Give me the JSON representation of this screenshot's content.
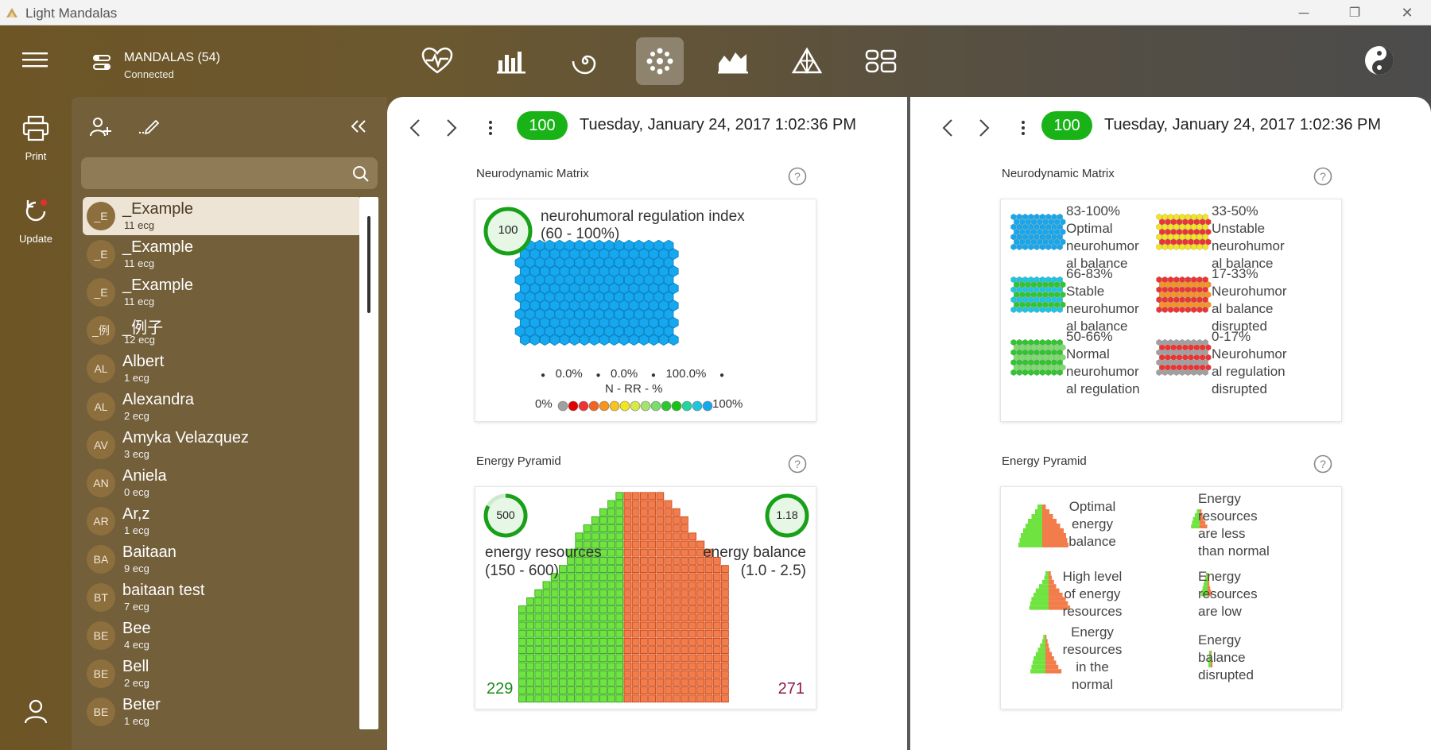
{
  "window": {
    "title": "Light Mandalas",
    "minimize": "─",
    "restore": "❐",
    "close": "✕"
  },
  "header": {
    "connection_title": "MANDALAS (54)",
    "connection_status": "Connected",
    "toolbar_icons": [
      "heart-pulse-icon",
      "bar-chart-icon",
      "spiral-icon",
      "mandala-icon",
      "area-chart-icon",
      "pyramid-icon",
      "layout-grid-icon"
    ],
    "active_icon": "mandala-icon"
  },
  "rail": {
    "print_label": "Print",
    "update_label": "Update"
  },
  "sidebar": {
    "search_placeholder": "",
    "items": [
      {
        "initials": "_E",
        "name": "_Example",
        "count": "11 ecg",
        "selected": true
      },
      {
        "initials": "_E",
        "name": "_Example",
        "count": "11 ecg",
        "selected": false
      },
      {
        "initials": "_E",
        "name": "_Example",
        "count": "11 ecg",
        "selected": false
      },
      {
        "initials": "_例",
        "name": "_例子",
        "count": "12 ecg",
        "selected": false
      },
      {
        "initials": "AL",
        "name": "Albert",
        "count": "1 ecg",
        "selected": false
      },
      {
        "initials": "AL",
        "name": "Alexandra",
        "count": "2 ecg",
        "selected": false
      },
      {
        "initials": "AV",
        "name": "Amyka Velazquez",
        "count": "3 ecg",
        "selected": false
      },
      {
        "initials": "AN",
        "name": "Aniela",
        "count": "0 ecg",
        "selected": false
      },
      {
        "initials": "AR",
        "name": "Ar,z",
        "count": "1 ecg",
        "selected": false
      },
      {
        "initials": "BA",
        "name": "Baitaan",
        "count": "9 ecg",
        "selected": false
      },
      {
        "initials": "BT",
        "name": "baitaan test",
        "count": "7 ecg",
        "selected": false
      },
      {
        "initials": "BE",
        "name": "Bee",
        "count": "4 ecg",
        "selected": false
      },
      {
        "initials": "BE",
        "name": "Bell",
        "count": "2 ecg",
        "selected": false
      },
      {
        "initials": "BE",
        "name": "Beter",
        "count": "1 ecg",
        "selected": false
      }
    ]
  },
  "left_panel": {
    "badge": "100",
    "date": "Tuesday, January 24, 2017 1:02:36 PM",
    "matrix_title": "Neurodynamic Matrix",
    "matrix": {
      "index_value": "100",
      "index_label_1": "neurohumoral regulation index",
      "index_label_2": "(60 - 100%)",
      "stats": [
        "0.0%",
        "0.0%",
        "100.0%"
      ],
      "axis_label": "N - RR - %",
      "scale_min": "0%",
      "scale_max": "100%",
      "scale_colors": [
        "#a0a0a0",
        "#e00000",
        "#ee3333",
        "#f26422",
        "#f7941d",
        "#f7c31d",
        "#f3e61d",
        "#d7e94a",
        "#a6e36b",
        "#7ddc6b",
        "#2ec82e",
        "#17c317",
        "#1fd6a0",
        "#1bc6e0",
        "#15a8ee"
      ],
      "cell_color": "#15a8ee"
    },
    "pyramid_title": "Energy Pyramid",
    "pyramid": {
      "resources_value": "500",
      "resources_fill": 0.83,
      "resources_label_1": "energy resources",
      "resources_label_2": "(150 - 600)",
      "balance_value": "1.18",
      "balance_label_1": "energy balance",
      "balance_label_2": "(1.0 - 2.5)",
      "left_count": "229",
      "right_count": "271",
      "left_color": "#6fe33f",
      "right_color": "#f27c4a"
    }
  },
  "right_panel": {
    "badge": "100",
    "date": "Tuesday, January 24, 2017 1:02:36 PM",
    "matrix_title": "Neurodynamic Matrix",
    "matrix_legend": [
      {
        "lines": [
          "83-100%",
          "Optimal",
          "neurohumor",
          "al balance"
        ],
        "palette": [
          "#15a8ee",
          "#1bb0f0",
          "#0f9be0"
        ]
      },
      {
        "lines": [
          "33-50%",
          "Unstable",
          "neurohumor",
          "al balance"
        ],
        "palette": [
          "#f3e61d",
          "#f7941d",
          "#ee3333",
          "#7ddc6b"
        ]
      },
      {
        "lines": [
          "66-83%",
          "Stable",
          "neurohumor",
          "al balance"
        ],
        "palette": [
          "#1bc6e0",
          "#15a8ee",
          "#2ec82e",
          "#7ddc6b"
        ]
      },
      {
        "lines": [
          "17-33%",
          "Neurohumor",
          "al balance",
          "disrupted"
        ],
        "palette": [
          "#ee3333",
          "#a0a0a0",
          "#f7941d",
          "#d04040"
        ]
      },
      {
        "lines": [
          "50-66%",
          "Normal",
          "neurohumor",
          "al regulation"
        ],
        "palette": [
          "#2ec82e",
          "#17c317",
          "#7ddc6b",
          "#a6e36b"
        ]
      },
      {
        "lines": [
          "0-17%",
          "Neurohumor",
          "al regulation",
          "disrupted"
        ],
        "palette": [
          "#a0a0a0",
          "#b8b8b8",
          "#ee3333",
          "#909090"
        ]
      }
    ],
    "pyramid_title": "Energy Pyramid",
    "pyramid_legend": [
      {
        "lines": [
          "Optimal",
          "energy",
          "balance"
        ]
      },
      {
        "lines": [
          "Energy",
          "resources",
          "are less",
          "than normal"
        ]
      },
      {
        "lines": [
          "High level",
          "of energy",
          "resources"
        ]
      },
      {
        "lines": [
          "Energy",
          "resources",
          "are low"
        ]
      },
      {
        "lines": [
          "Energy",
          "resources",
          "in the",
          "normal"
        ]
      },
      {
        "lines": [
          "Energy",
          "balance",
          "disrupted"
        ]
      }
    ]
  }
}
